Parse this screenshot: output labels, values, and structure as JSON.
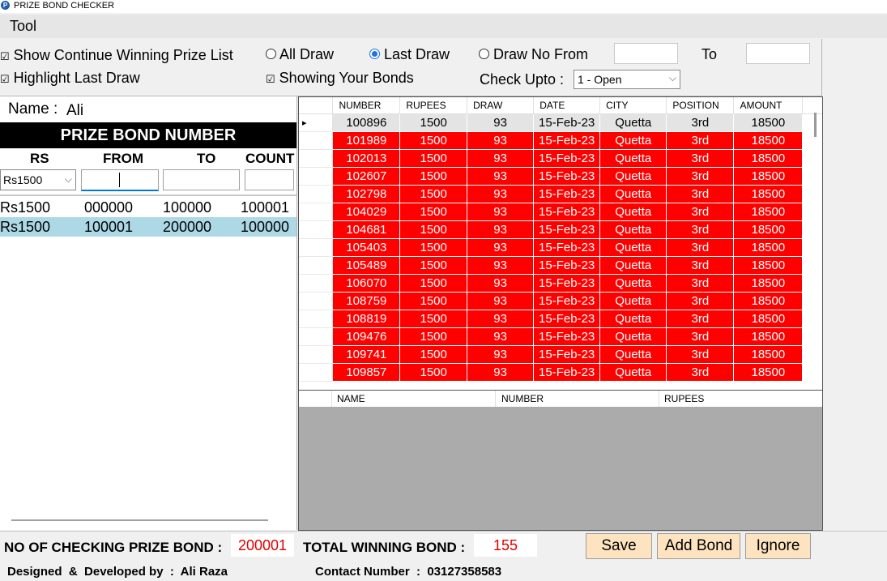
{
  "window": {
    "title": "PRIZE BOND CHECKER",
    "app_icon": "P"
  },
  "menu": {
    "tool": "Tool"
  },
  "options": {
    "show_continue": "Show Continue Winning Prize List",
    "highlight_last": "Highlight Last Draw",
    "showing_bonds": "Showing Your Bonds",
    "all_draw": "All Draw",
    "last_draw": "Last Draw",
    "draw_no_from": "Draw No From",
    "to": "To",
    "check_upto": "Check Upto :",
    "check_upto_value": "1 - Open",
    "draw_from_value": "",
    "draw_to_value": ""
  },
  "left": {
    "name_label": "Name :",
    "name_value": "Ali",
    "header": "PRIZE BOND NUMBER",
    "columns": [
      "RS",
      "FROM",
      "TO",
      "COUNT"
    ],
    "rs_select": "Rs1500",
    "rows": [
      {
        "rs": "Rs1500",
        "from": "000000",
        "to": "100000",
        "count": "100001"
      },
      {
        "rs": "Rs1500",
        "from": "100001",
        "to": "200000",
        "count": "100000"
      }
    ]
  },
  "grid": {
    "columns": [
      "NUMBER",
      "RUPEES",
      "DRAW",
      "DATE",
      "CITY",
      "POSITION",
      "AMOUNT"
    ],
    "rows": [
      [
        "100896",
        "1500",
        "93",
        "15-Feb-23",
        "Quetta",
        "3rd",
        "18500"
      ],
      [
        "101989",
        "1500",
        "93",
        "15-Feb-23",
        "Quetta",
        "3rd",
        "18500"
      ],
      [
        "102013",
        "1500",
        "93",
        "15-Feb-23",
        "Quetta",
        "3rd",
        "18500"
      ],
      [
        "102607",
        "1500",
        "93",
        "15-Feb-23",
        "Quetta",
        "3rd",
        "18500"
      ],
      [
        "102798",
        "1500",
        "93",
        "15-Feb-23",
        "Quetta",
        "3rd",
        "18500"
      ],
      [
        "104029",
        "1500",
        "93",
        "15-Feb-23",
        "Quetta",
        "3rd",
        "18500"
      ],
      [
        "104681",
        "1500",
        "93",
        "15-Feb-23",
        "Quetta",
        "3rd",
        "18500"
      ],
      [
        "105403",
        "1500",
        "93",
        "15-Feb-23",
        "Quetta",
        "3rd",
        "18500"
      ],
      [
        "105489",
        "1500",
        "93",
        "15-Feb-23",
        "Quetta",
        "3rd",
        "18500"
      ],
      [
        "106070",
        "1500",
        "93",
        "15-Feb-23",
        "Quetta",
        "3rd",
        "18500"
      ],
      [
        "108759",
        "1500",
        "93",
        "15-Feb-23",
        "Quetta",
        "3rd",
        "18500"
      ],
      [
        "108819",
        "1500",
        "93",
        "15-Feb-23",
        "Quetta",
        "3rd",
        "18500"
      ],
      [
        "109476",
        "1500",
        "93",
        "15-Feb-23",
        "Quetta",
        "3rd",
        "18500"
      ],
      [
        "109741",
        "1500",
        "93",
        "15-Feb-23",
        "Quetta",
        "3rd",
        "18500"
      ],
      [
        "109857",
        "1500",
        "93",
        "15-Feb-23",
        "Quetta",
        "3rd",
        "18500"
      ]
    ],
    "row_color": "#ff0000"
  },
  "grid2": {
    "columns": [
      "NAME",
      "NUMBER",
      "RUPEES"
    ]
  },
  "bottom": {
    "no_checking_label": "NO OF CHECKING PRIZE BOND :",
    "no_checking_value": "200001",
    "total_winning_label": "TOTAL WINNING BOND :",
    "total_winning_value": "155",
    "save": "Save",
    "add_bond": "Add Bond",
    "ignore": "Ignore",
    "designed_label": "Designed  &  Developed by  :  Ali Raza",
    "contact_label": "Contact Number  :  03127358583"
  }
}
